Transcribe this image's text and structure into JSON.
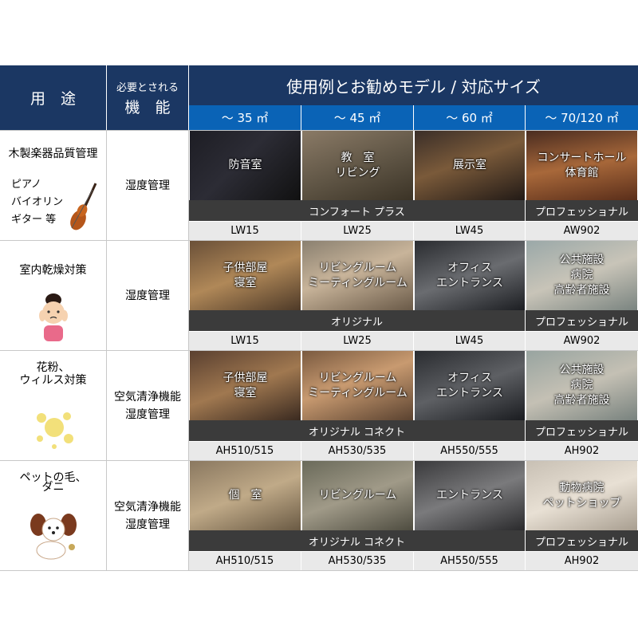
{
  "header": {
    "usage": "用　途",
    "function_top": "必要とされる",
    "function_bottom": "機　能",
    "examples_title": "使用例とお勧めモデル / 対応サイズ",
    "sizes": [
      "～ 35 ㎡",
      "～ 45 ㎡",
      "～ 60 ㎡",
      "～ 70/120 ㎡"
    ]
  },
  "rows": [
    {
      "usage_title": "木製楽器品質管理",
      "usage_sub": [
        "ピアノ",
        "バイオリン",
        "ギター 等"
      ],
      "illustration": "violin-icon",
      "function": [
        "湿度管理"
      ],
      "photos": [
        [
          "防音室"
        ],
        [
          "教　室",
          "リビング"
        ],
        [
          "展示室"
        ],
        [
          "コンサートホール",
          "体育館"
        ]
      ],
      "series_main": "コンフォート プラス",
      "series_pro": "プロフェッショナル",
      "models": [
        "LW15",
        "LW25",
        "LW45",
        "AW902"
      ]
    },
    {
      "usage_title": "室内乾燥対策",
      "usage_sub": [],
      "illustration": "dry-skin-woman-icon",
      "function": [
        "湿度管理"
      ],
      "photos": [
        [
          "子供部屋",
          "寝室"
        ],
        [
          "リビングルーム",
          "ミーティングルーム"
        ],
        [
          "オフィス",
          "エントランス"
        ],
        [
          "公共施設",
          "病院",
          "高齢者施設"
        ]
      ],
      "series_main": "オリジナル",
      "series_pro": "プロフェッショナル",
      "models": [
        "LW15",
        "LW25",
        "LW45",
        "AW902"
      ]
    },
    {
      "usage_title": "花粉、",
      "usage_title2": "ウィルス対策",
      "usage_sub": [],
      "illustration": "pollen-icon",
      "function": [
        "空気清浄機能",
        "湿度管理"
      ],
      "photos": [
        [
          "子供部屋",
          "寝室"
        ],
        [
          "リビングルーム",
          "ミーティングルーム"
        ],
        [
          "オフィス",
          "エントランス"
        ],
        [
          "公共施設",
          "病院",
          "高齢者施設"
        ]
      ],
      "series_main": "オリジナル コネクト",
      "series_pro": "プロフェッショナル",
      "models": [
        "AH510/515",
        "AH530/535",
        "AH550/555",
        "AH902"
      ]
    },
    {
      "usage_title": "ペットの毛、",
      "usage_title2": "ダニ",
      "usage_sub": [],
      "illustration": "dog-icon",
      "function": [
        "空気清浄機能",
        "湿度管理"
      ],
      "photos": [
        [
          "個　室"
        ],
        [
          "リビングルーム"
        ],
        [
          "エントランス"
        ],
        [
          "動物病院",
          "ペットショップ"
        ]
      ],
      "series_main": "オリジナル コネクト",
      "series_pro": "プロフェッショナル",
      "models": [
        "AH510/515",
        "AH530/535",
        "AH550/555",
        "AH902"
      ]
    }
  ]
}
